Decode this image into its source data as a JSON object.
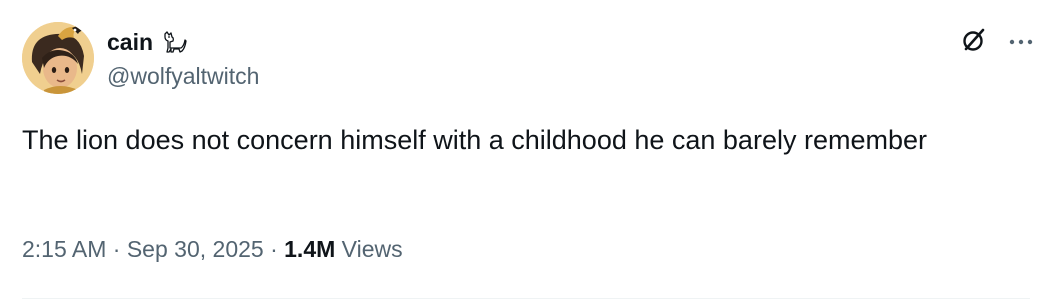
{
  "tweet": {
    "display_name": "cain",
    "handle": "@wolfyaltwitch",
    "text": "The lion does not concern himself with a childhood he can barely remember",
    "time": "2:15 AM",
    "separator_1": " · ",
    "date": "Sep 30, 2025",
    "separator_2": " · ",
    "views_count": "1.4M",
    "views_label": " Views"
  },
  "icons": {
    "name_emoji": "dog-emoji-icon",
    "grok": "grok-icon",
    "more": "more-horizontal-icon"
  },
  "colors": {
    "primary_text": "#0f1419",
    "secondary_text": "#536471",
    "divider": "#eff3f4"
  }
}
